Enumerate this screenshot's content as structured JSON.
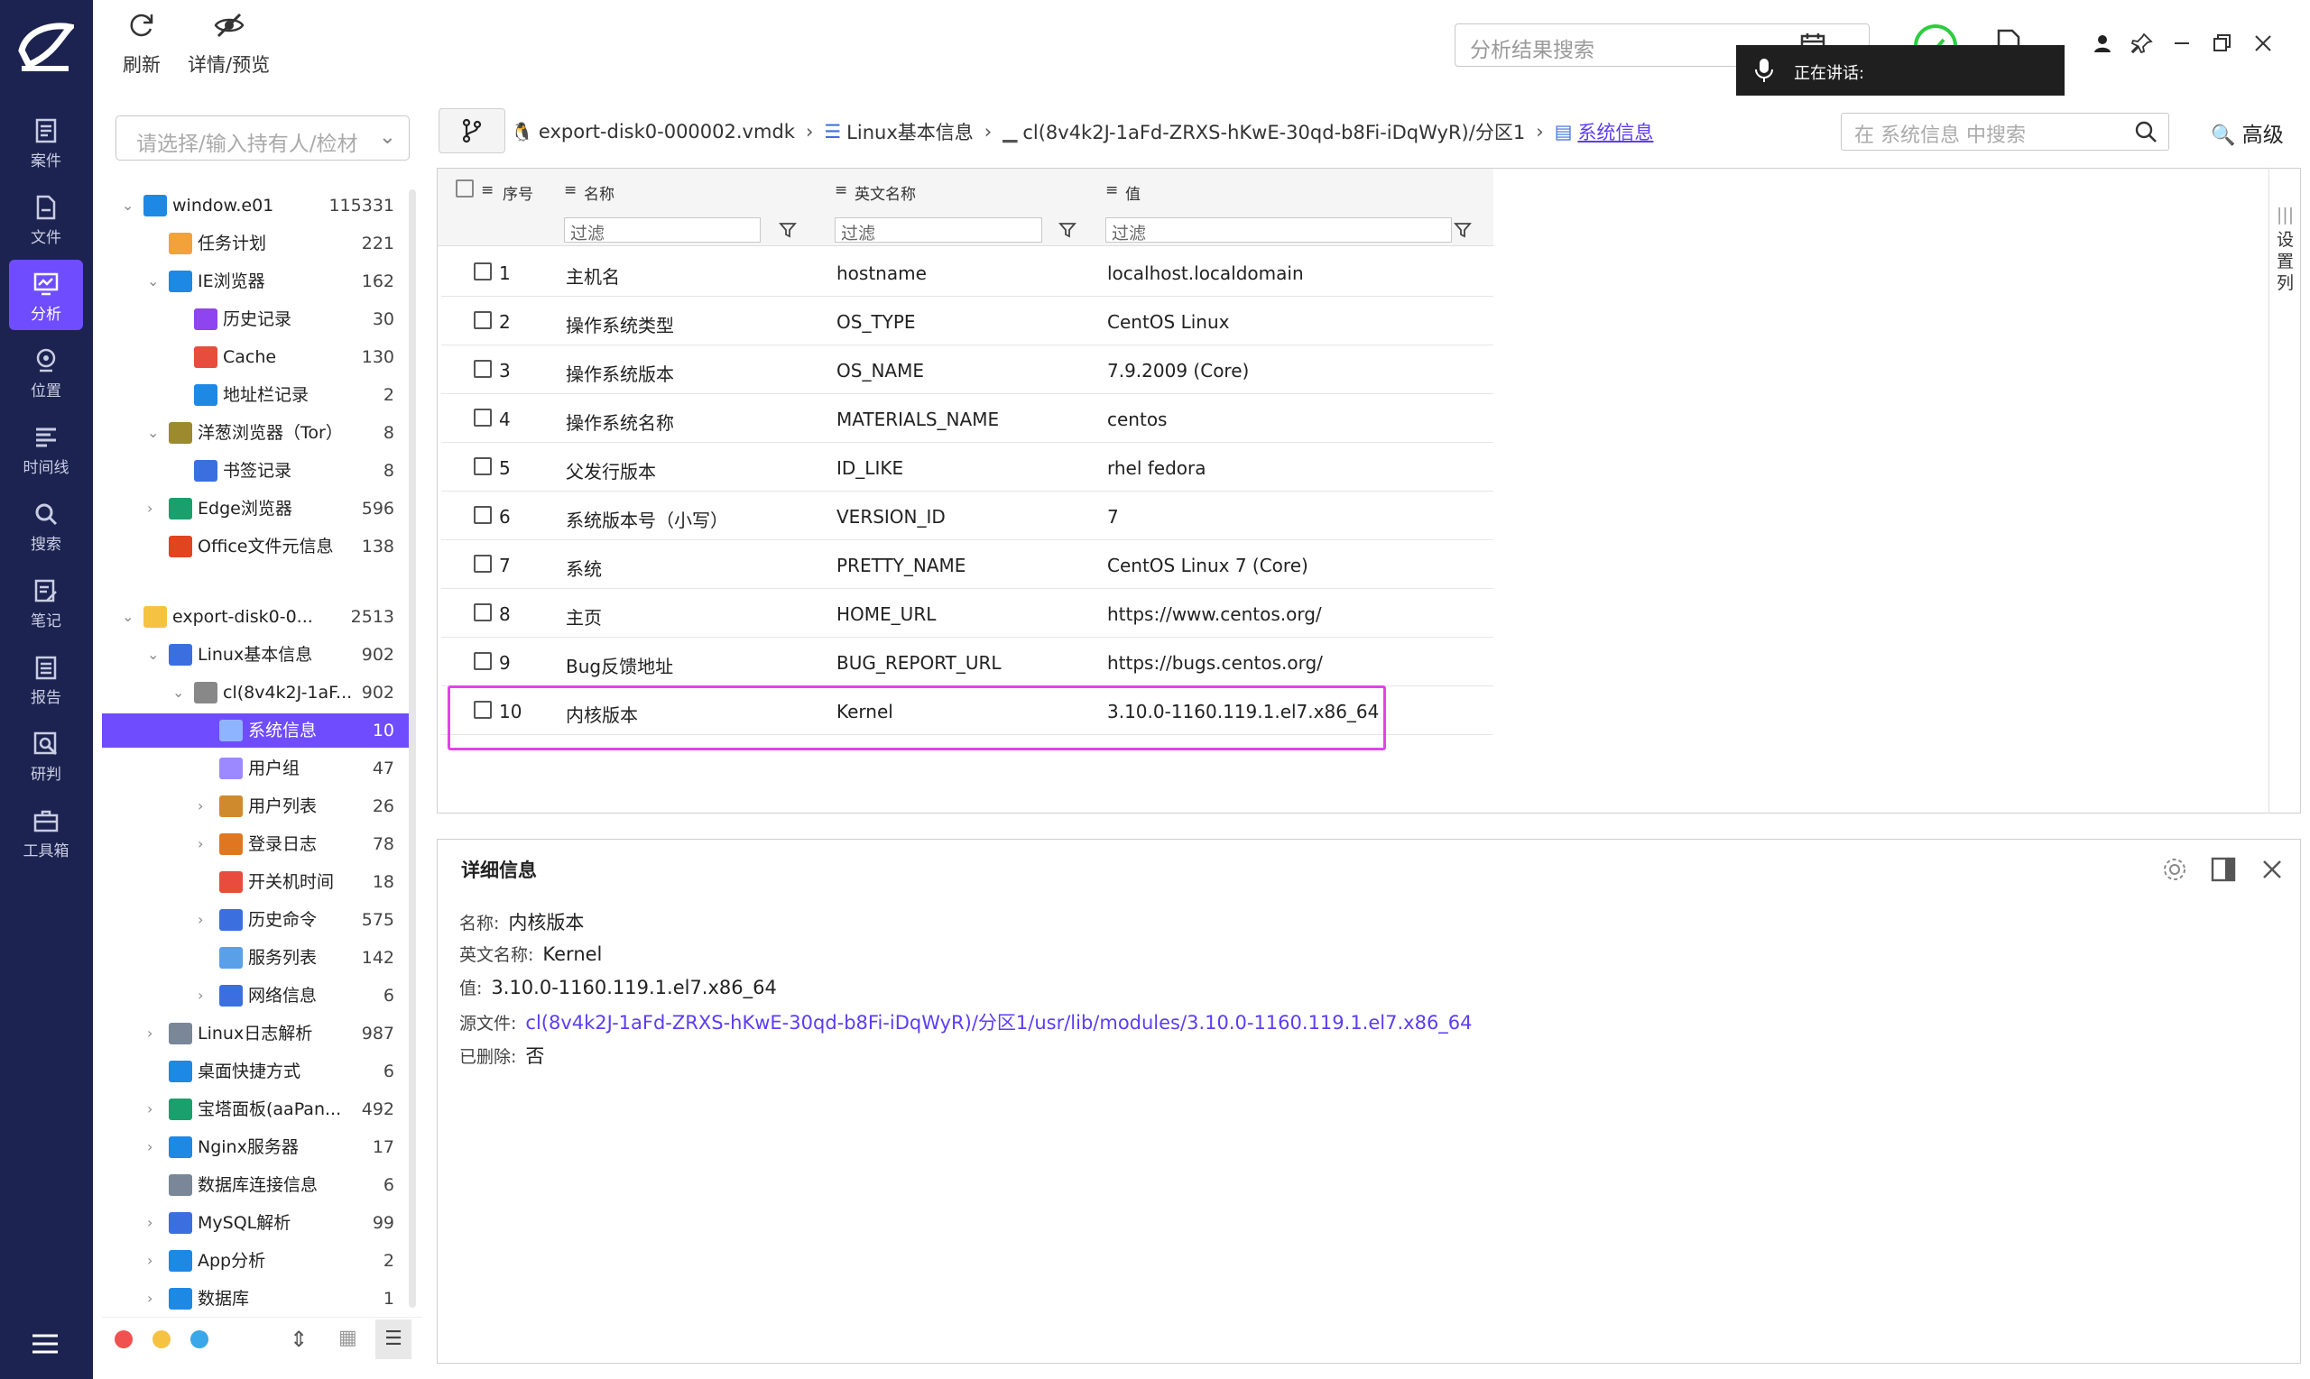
{
  "toolbar": {
    "refresh": "刷新",
    "preview": "详情/预览"
  },
  "rail": [
    "案件",
    "文件",
    "分析",
    "位置",
    "时间线",
    "搜索",
    "笔记",
    "报告",
    "研判",
    "工具箱"
  ],
  "header": {
    "search_placeholder": "分析结果搜索",
    "speaking": "正在讲话:"
  },
  "tree": {
    "select_placeholder": "请选择/输入持有人/检材",
    "items": [
      {
        "label": "window.e01",
        "count": "115331"
      },
      {
        "label": "任务计划",
        "count": "221"
      },
      {
        "label": "IE浏览器",
        "count": "162"
      },
      {
        "label": "历史记录",
        "count": "30"
      },
      {
        "label": "Cache",
        "count": "130"
      },
      {
        "label": "地址栏记录",
        "count": "2"
      },
      {
        "label": "洋葱浏览器（Tor）",
        "count": "8"
      },
      {
        "label": "书签记录",
        "count": "8"
      },
      {
        "label": "Edge浏览器",
        "count": "596"
      },
      {
        "label": "Office文件元信息",
        "count": "138"
      },
      {
        "label": "export-disk0-0...",
        "count": "2513"
      },
      {
        "label": "Linux基本信息",
        "count": "902"
      },
      {
        "label": "cl(8v4k2J-1aF...",
        "count": "902"
      },
      {
        "label": "系统信息",
        "count": "10"
      },
      {
        "label": "用户组",
        "count": "47"
      },
      {
        "label": "用户列表",
        "count": "26"
      },
      {
        "label": "登录日志",
        "count": "78"
      },
      {
        "label": "开关机时间",
        "count": "18"
      },
      {
        "label": "历史命令",
        "count": "575"
      },
      {
        "label": "服务列表",
        "count": "142"
      },
      {
        "label": "网络信息",
        "count": "6"
      },
      {
        "label": "Linux日志解析",
        "count": "987"
      },
      {
        "label": "桌面快捷方式",
        "count": "6"
      },
      {
        "label": "宝塔面板(aaPan...",
        "count": "492"
      },
      {
        "label": "Nginx服务器",
        "count": "17"
      },
      {
        "label": "数据库连接信息",
        "count": "6"
      },
      {
        "label": "MySQL解析",
        "count": "99"
      },
      {
        "label": "App分析",
        "count": "2"
      },
      {
        "label": "数据库",
        "count": "1"
      }
    ]
  },
  "breadcrumb": {
    "b1": "export-disk0-000002.vmdk",
    "b2": "Linux基本信息",
    "b3": "cl(8v4k2J-1aFd-ZRXS-hKwE-30qd-b8Fi-iDqWyR)/分区1",
    "b4": "系统信息"
  },
  "grid": {
    "search_placeholder": "在 系统信息 中搜索",
    "advanced": "高级",
    "settings_col": "设置列",
    "columns": {
      "index": "序号",
      "name": "名称",
      "en_name": "英文名称",
      "value": "值"
    },
    "filter": "过滤",
    "rows": [
      {
        "idx": "1",
        "name": "主机名",
        "en": "hostname",
        "val": "localhost.localdomain"
      },
      {
        "idx": "2",
        "name": "操作系统类型",
        "en": "OS_TYPE",
        "val": "CentOS Linux"
      },
      {
        "idx": "3",
        "name": "操作系统版本",
        "en": "OS_NAME",
        "val": "7.9.2009 (Core)"
      },
      {
        "idx": "4",
        "name": "操作系统名称",
        "en": "MATERIALS_NAME",
        "val": "centos"
      },
      {
        "idx": "5",
        "name": "父发行版本",
        "en": "ID_LIKE",
        "val": "rhel fedora"
      },
      {
        "idx": "6",
        "name": "系统版本号（小写）",
        "en": "VERSION_ID",
        "val": "7"
      },
      {
        "idx": "7",
        "name": "系统",
        "en": "PRETTY_NAME",
        "val": "CentOS Linux 7 (Core)"
      },
      {
        "idx": "8",
        "name": "主页",
        "en": "HOME_URL",
        "val": "https://www.centos.org/"
      },
      {
        "idx": "9",
        "name": "Bug反馈地址",
        "en": "BUG_REPORT_URL",
        "val": "https://bugs.centos.org/"
      },
      {
        "idx": "10",
        "name": "内核版本",
        "en": "Kernel",
        "val": "3.10.0-1160.119.1.el7.x86_64"
      }
    ]
  },
  "detail": {
    "title": "详细信息",
    "name_label": "名称:",
    "name": "内核版本",
    "en_label": "英文名称:",
    "en": "Kernel",
    "val_label": "值:",
    "val": "3.10.0-1160.119.1.el7.x86_64",
    "src_label": "源文件:",
    "src": "cl(8v4k2J-1aFd-ZRXS-hKwE-30qd-b8Fi-iDqWyR)/分区1/usr/lib/modules/3.10.0-1160.119.1.el7.x86_64",
    "del_label": "已删除:",
    "del": "否"
  },
  "colors": {
    "rail": "#1c2350",
    "accent": "#6f4dff",
    "highlight": "#e243e8"
  }
}
